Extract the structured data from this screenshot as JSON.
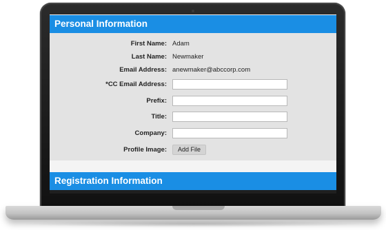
{
  "sections": {
    "personal_title": "Personal Information",
    "registration_title": "Registration Information"
  },
  "form": {
    "first_name": {
      "label": "First Name:",
      "value": "Adam"
    },
    "last_name": {
      "label": "Last Name:",
      "value": "Newmaker"
    },
    "email": {
      "label": "Email Address:",
      "value": "anewmaker@abccorp.com"
    },
    "cc_email": {
      "label": "*CC Email Address:",
      "value": ""
    },
    "prefix": {
      "label": "Prefix:",
      "value": ""
    },
    "title": {
      "label": "Title:",
      "value": ""
    },
    "company": {
      "label": "Company:",
      "value": ""
    },
    "profile_image": {
      "label": "Profile Image:",
      "button": "Add File"
    }
  },
  "colors": {
    "header": "#1a8ee4",
    "form_background": "#e3e3e3"
  }
}
